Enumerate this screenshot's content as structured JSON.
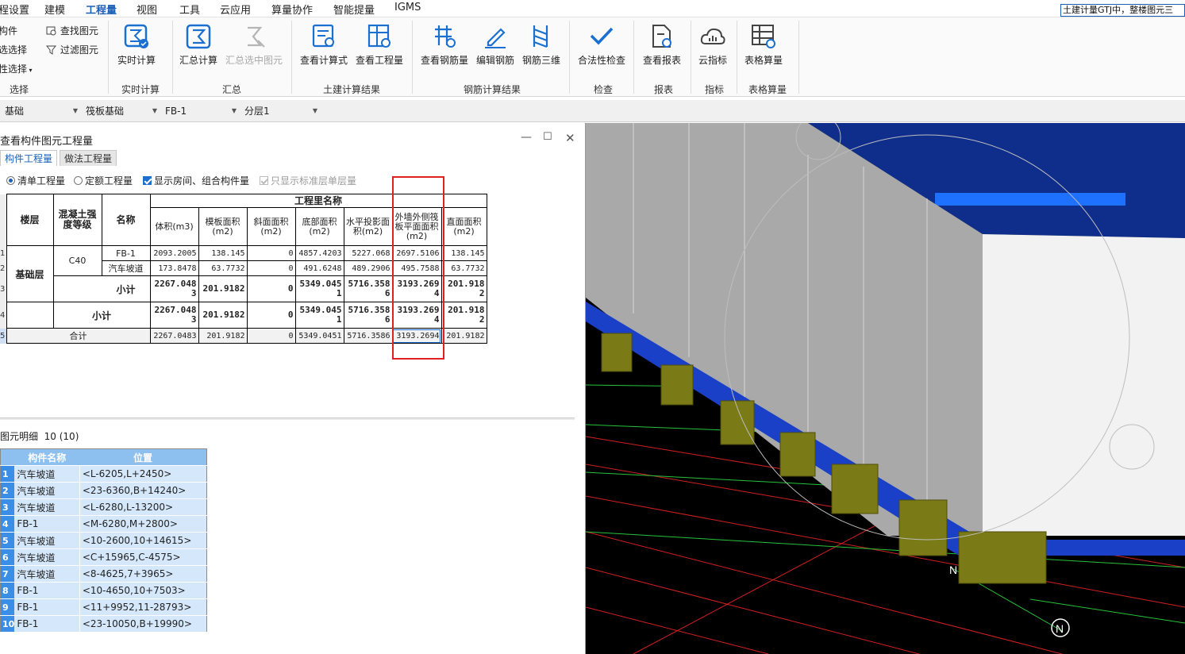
{
  "menubar": {
    "items": [
      "程设置",
      "建模",
      "工程量",
      "视图",
      "工具",
      "云应用",
      "算量协作",
      "智能提量",
      "IGMS"
    ],
    "active": "工程量",
    "search_text": "土建计量GTJ中，整楼图元三"
  },
  "ribbon": {
    "select_group": {
      "items": [
        "构件",
        "查找图元",
        "选选择",
        "过滤图元",
        "性选择"
      ],
      "label": "选择"
    },
    "groups": [
      {
        "label": "实时计算",
        "buttons": [
          "实时计算"
        ]
      },
      {
        "label": "汇总",
        "buttons": [
          "汇总计算",
          "汇总选中图元"
        ]
      },
      {
        "label": "土建计算结果",
        "buttons": [
          "查看计算式",
          "查看工程量"
        ]
      },
      {
        "label": "钢筋计算结果",
        "buttons": [
          "查看钢筋量",
          "编辑钢筋",
          "钢筋三维"
        ]
      },
      {
        "label": "检查",
        "buttons": [
          "合法性检查"
        ]
      },
      {
        "label": "报表",
        "buttons": [
          "查看报表"
        ]
      },
      {
        "label": "指标",
        "buttons": [
          "云指标"
        ]
      },
      {
        "label": "表格算量",
        "buttons": [
          "表格算量"
        ]
      }
    ],
    "disabled_buttons": [
      "汇总选中图元"
    ],
    "accent_color": "#1a6fd0"
  },
  "selectors": [
    "基础",
    "筏板基础",
    "FB-1",
    "分层1"
  ],
  "dialog": {
    "title": "查看构件图元工程量",
    "tabs": [
      "构件工程量",
      "做法工程量"
    ],
    "active_tab": "构件工程量",
    "options": {
      "radio_bill": "清单工程量",
      "radio_quota": "定额工程量",
      "check_room": "显示房间、组合构件量",
      "check_standard": "只显示标准层单层量"
    },
    "table": {
      "group_header": "工程里名称",
      "col_floor": "楼层",
      "col_grade": "混凝土强度等级",
      "col_name": "名称",
      "columns": [
        "体积(m3)",
        "模板面积(m2)",
        "斜面面积(m2)",
        "底部面积(m2)",
        "水平投影面积(m2)",
        "外墙外侧筏板平面面积(m2)",
        "直面面积(m2)"
      ],
      "floor": "基础层",
      "grade": "C40",
      "row_numbers": [
        "1",
        "2",
        "3",
        "4",
        "5"
      ],
      "rows": [
        {
          "name": "FB-1",
          "values": [
            "2093.2005",
            "138.145",
            "0",
            "4857.4203",
            "5227.068",
            "2697.5106",
            "138.145"
          ]
        },
        {
          "name": "汽车坡道",
          "values": [
            "173.8478",
            "63.7732",
            "0",
            "491.6248",
            "489.2906",
            "495.7588",
            "63.7732"
          ]
        }
      ],
      "subtotal_label": "小计",
      "subtotal_values": [
        "2267.0483",
        "201.9182",
        "0",
        "5349.0451",
        "5716.3586",
        "3193.2694",
        "201.9182"
      ],
      "floor_subtotal_label": "小计",
      "floor_subtotal_values": [
        "2267.0483",
        "201.9182",
        "0",
        "5349.0451",
        "5716.3586",
        "3193.2694",
        "201.9182"
      ],
      "total_label": "合计",
      "total_values": [
        "2267.0483",
        "201.9182",
        "0",
        "5349.0451",
        "5716.3586",
        "3193.2694",
        "201.9182"
      ]
    },
    "detail": {
      "title": "图元明细",
      "count": "10 (10)",
      "headers": [
        "构件名称",
        "位置"
      ],
      "rows": [
        {
          "no": "1",
          "name": "汽车坡道",
          "position": "<L-6205,L+2450>"
        },
        {
          "no": "2",
          "name": "汽车坡道",
          "position": "<23-6360,B+14240>"
        },
        {
          "no": "3",
          "name": "汽车坡道",
          "position": "<L-6280,L-13200>"
        },
        {
          "no": "4",
          "name": "FB-1",
          "position": "<M-6280,M+2800>"
        },
        {
          "no": "5",
          "name": "汽车坡道",
          "position": "<10-2600,10+14615>"
        },
        {
          "no": "6",
          "name": "汽车坡道",
          "position": "<C+15965,C-4575>"
        },
        {
          "no": "7",
          "name": "汽车坡道",
          "position": "<8-4625,7+3965>"
        },
        {
          "no": "8",
          "name": "FB-1",
          "position": "<10-4650,10+7503>"
        },
        {
          "no": "9",
          "name": "FB-1",
          "position": "<11+9952,11-28793>"
        },
        {
          "no": "10",
          "name": "FB-1",
          "position": "<23-10050,B+19990>"
        }
      ]
    }
  },
  "viewport": {
    "north_labels": [
      "N",
      "N"
    ],
    "colors": {
      "background": "#000000",
      "slab": "#0f2e8c",
      "wall": "#ececec",
      "footing": "#7a7a16",
      "grid_red": "#d42020",
      "grid_green": "#27c23a"
    }
  }
}
